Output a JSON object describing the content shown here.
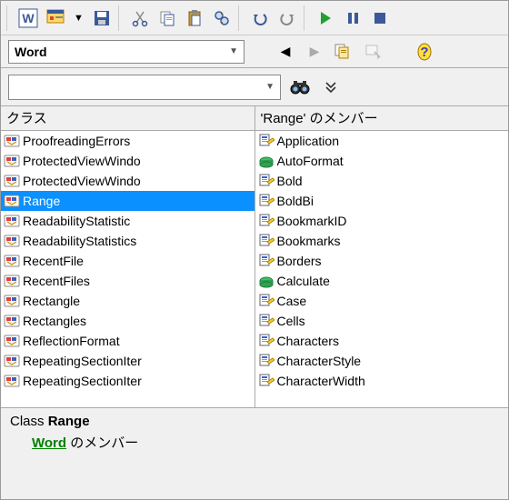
{
  "toolbar_top": {
    "word_btn": "W",
    "form_btn": "form",
    "dropdown": "▼",
    "save": "save",
    "cut": "cut",
    "copy": "copy",
    "paste": "paste",
    "find": "find",
    "undo": "undo",
    "redo": "redo",
    "run": "run",
    "pause": "pause",
    "stop": "stop"
  },
  "library": {
    "selected": "Word",
    "nav_back": "◀",
    "nav_forward": "▶",
    "copy_icon": "copy",
    "help_icon": "?"
  },
  "search": {
    "value": "",
    "find_icon": "binoculars",
    "expand_icon": "»"
  },
  "classes": {
    "header": "クラス",
    "items": [
      {
        "label": "ProofreadingErrors",
        "icon": "class",
        "selected": false
      },
      {
        "label": "ProtectedViewWindo",
        "icon": "class",
        "selected": false
      },
      {
        "label": "ProtectedViewWindo",
        "icon": "class",
        "selected": false
      },
      {
        "label": "Range",
        "icon": "class",
        "selected": true
      },
      {
        "label": "ReadabilityStatistic",
        "icon": "class",
        "selected": false
      },
      {
        "label": "ReadabilityStatistics",
        "icon": "class",
        "selected": false
      },
      {
        "label": "RecentFile",
        "icon": "class",
        "selected": false
      },
      {
        "label": "RecentFiles",
        "icon": "class",
        "selected": false
      },
      {
        "label": "Rectangle",
        "icon": "class",
        "selected": false
      },
      {
        "label": "Rectangles",
        "icon": "class",
        "selected": false
      },
      {
        "label": "ReflectionFormat",
        "icon": "class",
        "selected": false
      },
      {
        "label": "RepeatingSectionIter",
        "icon": "class",
        "selected": false
      },
      {
        "label": "RepeatingSectionIter",
        "icon": "class",
        "selected": false
      }
    ]
  },
  "members": {
    "header": "'Range' のメンバー",
    "items": [
      {
        "label": "Application",
        "icon": "property"
      },
      {
        "label": "AutoFormat",
        "icon": "method"
      },
      {
        "label": "Bold",
        "icon": "property"
      },
      {
        "label": "BoldBi",
        "icon": "property"
      },
      {
        "label": "BookmarkID",
        "icon": "property"
      },
      {
        "label": "Bookmarks",
        "icon": "property"
      },
      {
        "label": "Borders",
        "icon": "property"
      },
      {
        "label": "Calculate",
        "icon": "method"
      },
      {
        "label": "Case",
        "icon": "property"
      },
      {
        "label": "Cells",
        "icon": "property"
      },
      {
        "label": "Characters",
        "icon": "property"
      },
      {
        "label": "CharacterStyle",
        "icon": "property"
      },
      {
        "label": "CharacterWidth",
        "icon": "property"
      }
    ]
  },
  "detail": {
    "class_label": "Class",
    "class_name": "Range",
    "parent_link": "Word",
    "member_suffix": "のメンバー"
  }
}
